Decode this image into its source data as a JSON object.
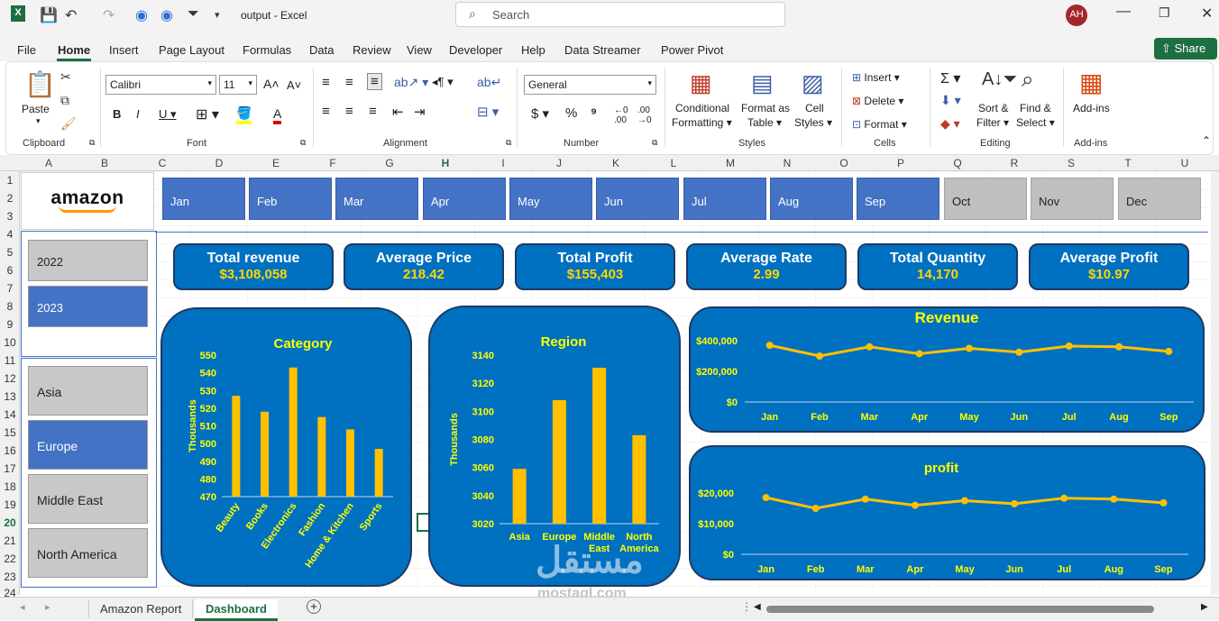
{
  "titlebar": {
    "filename": "output",
    "app": "Excel",
    "search_placeholder": "Search",
    "avatar": "AH"
  },
  "menu": [
    "File",
    "Home",
    "Insert",
    "Page Layout",
    "Formulas",
    "Data",
    "Review",
    "View",
    "Developer",
    "Help",
    "Data Streamer",
    "Power Pivot"
  ],
  "share_label": "Share",
  "ribbon": {
    "clipboard": {
      "paste": "Paste",
      "group": "Clipboard"
    },
    "font": {
      "name": "Calibri",
      "size": "11",
      "group": "Font"
    },
    "alignment": {
      "group": "Alignment"
    },
    "number": {
      "format": "General",
      "group": "Number"
    },
    "styles": {
      "conditional_1": "Conditional",
      "conditional_2": "Formatting",
      "format_table_1": "Format as",
      "format_table_2": "Table",
      "cell_styles_1": "Cell",
      "cell_styles_2": "Styles",
      "group": "Styles"
    },
    "cells": {
      "insert": "Insert",
      "delete": "Delete",
      "format": "Format",
      "group": "Cells"
    },
    "editing": {
      "sort_1": "Sort &",
      "sort_2": "Filter",
      "find_1": "Find &",
      "find_2": "Select",
      "group": "Editing"
    },
    "addins": {
      "label": "Add-ins",
      "group": "Add-ins"
    }
  },
  "columns": [
    "A",
    "B",
    "C",
    "D",
    "E",
    "F",
    "G",
    "H",
    "I",
    "J",
    "K",
    "L",
    "M",
    "N",
    "O",
    "P",
    "Q",
    "R",
    "S",
    "T",
    "U"
  ],
  "rows": [
    "1",
    "2",
    "3",
    "4",
    "5",
    "6",
    "7",
    "8",
    "9",
    "10",
    "11",
    "12",
    "13",
    "14",
    "15",
    "16",
    "17",
    "18",
    "19",
    "20",
    "21",
    "22",
    "23",
    "24"
  ],
  "logo": "amazon",
  "months": [
    {
      "label": "Jan",
      "active": true
    },
    {
      "label": "Feb",
      "active": true
    },
    {
      "label": "Mar",
      "active": true
    },
    {
      "label": "Apr",
      "active": true
    },
    {
      "label": "May",
      "active": true
    },
    {
      "label": "Jun",
      "active": true
    },
    {
      "label": "Jul",
      "active": true
    },
    {
      "label": "Aug",
      "active": true
    },
    {
      "label": "Sep",
      "active": true
    },
    {
      "label": "Oct",
      "active": false
    },
    {
      "label": "Nov",
      "active": false
    },
    {
      "label": "Dec",
      "active": false
    }
  ],
  "years": [
    {
      "label": "2022",
      "active": false
    },
    {
      "label": "2023",
      "active": true
    }
  ],
  "regions": [
    {
      "label": "Asia",
      "active": false
    },
    {
      "label": "Europe",
      "active": true
    },
    {
      "label": "Middle East",
      "active": false
    },
    {
      "label": "North America",
      "active": false
    }
  ],
  "kpis": [
    {
      "title": "Total revenue",
      "value": "$3,108,058"
    },
    {
      "title": "Average Price",
      "value": "218.42"
    },
    {
      "title": "Total Profit",
      "value": "$155,403"
    },
    {
      "title": "Average Rate",
      "value": "2.99"
    },
    {
      "title": "Total Quantity",
      "value": "14,170"
    },
    {
      "title": "Average Profit",
      "value": "$10.97"
    }
  ],
  "chart_data": [
    {
      "type": "bar",
      "title": "Category",
      "ylabel": "Thousands",
      "categories": [
        "Beauty",
        "Books",
        "Electronics",
        "Fashion",
        "Home & Kitchen",
        "Sports"
      ],
      "values": [
        527,
        518,
        543,
        515,
        508,
        497
      ],
      "ylim": [
        470,
        550
      ],
      "yticks": [
        "470",
        "480",
        "490",
        "500",
        "510",
        "520",
        "530",
        "540",
        "550"
      ],
      "color": "#ffc000"
    },
    {
      "type": "bar",
      "title": "Region",
      "ylabel": "Thousands",
      "categories": [
        "Asia",
        "Europe",
        "Middle East",
        "North America"
      ],
      "values": [
        3059,
        3108,
        3131,
        3083
      ],
      "ylim": [
        3020,
        3140
      ],
      "yticks": [
        "3020",
        "3040",
        "3060",
        "3080",
        "3100",
        "3120",
        "3140"
      ],
      "color": "#ffc000"
    },
    {
      "type": "line",
      "title": "Revenue",
      "categories": [
        "Jan",
        "Feb",
        "Mar",
        "Apr",
        "May",
        "Jun",
        "Jul",
        "Aug",
        "Sep"
      ],
      "values": [
        370000,
        300000,
        360000,
        315000,
        350000,
        325000,
        365000,
        360000,
        330000
      ],
      "ylim": [
        0,
        400000
      ],
      "yticks": [
        "$0",
        "$200,000",
        "$400,000"
      ],
      "color": "#ffc000"
    },
    {
      "type": "line",
      "title": "profit",
      "categories": [
        "Jan",
        "Feb",
        "Mar",
        "Apr",
        "May",
        "Jun",
        "Jul",
        "Aug",
        "Sep"
      ],
      "values": [
        18500,
        15000,
        18000,
        16000,
        17500,
        16500,
        18300,
        18000,
        16800
      ],
      "ylim": [
        0,
        20000
      ],
      "yticks": [
        "$0",
        "$10,000",
        "$20,000"
      ],
      "color": "#ffc000"
    }
  ],
  "sheets": [
    {
      "label": "Amazon Report",
      "active": false
    },
    {
      "label": "Dashboard",
      "active": true
    }
  ],
  "watermark": {
    "arabic": "مستقل",
    "latin": "mostaql.com"
  }
}
